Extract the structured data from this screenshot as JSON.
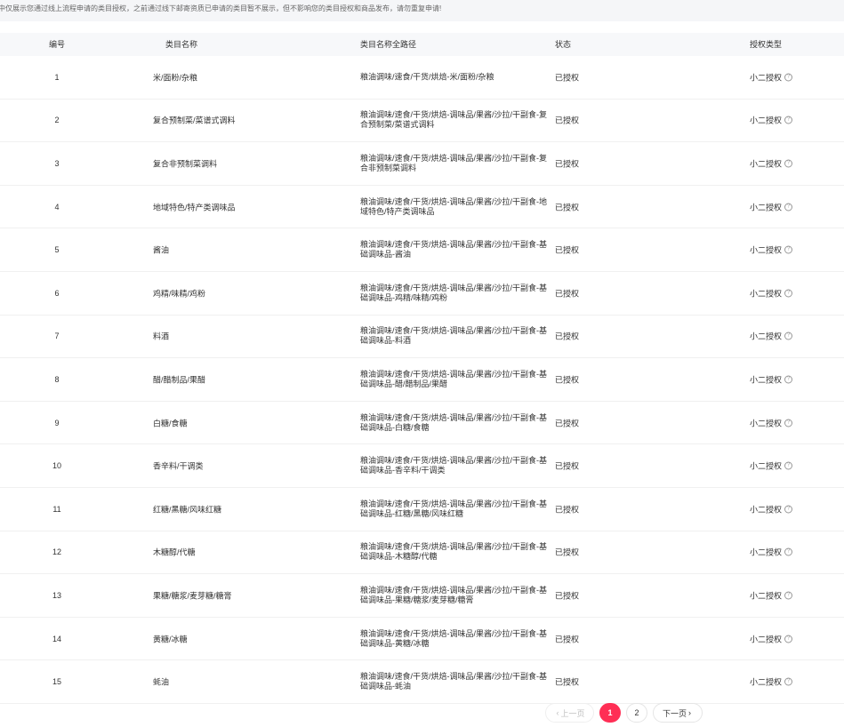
{
  "notice": "中仅展示您通过线上流程申请的类目授权，之前通过线下邮寄资质已申请的类目暂不展示，但不影响您的类目授权和商品发布，请勿重复申请!",
  "table": {
    "headers": {
      "no": "编号",
      "name": "类目名称",
      "path": "类目名称全路径",
      "status": "状态",
      "type": "授权类型"
    },
    "rows": [
      {
        "no": "1",
        "name": "米/面粉/杂粮",
        "path": "粮油调味/速食/干货/烘焙-米/面粉/杂粮",
        "status": "已授权",
        "type": "小二授权"
      },
      {
        "no": "2",
        "name": "复合预制菜/菜谱式调料",
        "path": "粮油调味/速食/干货/烘焙-调味品/果酱/沙拉/干副食-复合预制菜/菜谱式调料",
        "status": "已授权",
        "type": "小二授权"
      },
      {
        "no": "3",
        "name": "复合非预制菜调料",
        "path": "粮油调味/速食/干货/烘焙-调味品/果酱/沙拉/干副食-复合非预制菜调料",
        "status": "已授权",
        "type": "小二授权"
      },
      {
        "no": "4",
        "name": "地域特色/特产类调味品",
        "path": "粮油调味/速食/干货/烘焙-调味品/果酱/沙拉/干副食-地域特色/特产类调味品",
        "status": "已授权",
        "type": "小二授权"
      },
      {
        "no": "5",
        "name": "酱油",
        "path": "粮油调味/速食/干货/烘焙-调味品/果酱/沙拉/干副食-基础调味品-酱油",
        "status": "已授权",
        "type": "小二授权"
      },
      {
        "no": "6",
        "name": "鸡精/味精/鸡粉",
        "path": "粮油调味/速食/干货/烘焙-调味品/果酱/沙拉/干副食-基础调味品-鸡精/味精/鸡粉",
        "status": "已授权",
        "type": "小二授权"
      },
      {
        "no": "7",
        "name": "料酒",
        "path": "粮油调味/速食/干货/烘焙-调味品/果酱/沙拉/干副食-基础调味品-料酒",
        "status": "已授权",
        "type": "小二授权"
      },
      {
        "no": "8",
        "name": "醋/醋制品/果醋",
        "path": "粮油调味/速食/干货/烘焙-调味品/果酱/沙拉/干副食-基础调味品-醋/醋制品/果醋",
        "status": "已授权",
        "type": "小二授权"
      },
      {
        "no": "9",
        "name": "白糖/食糖",
        "path": "粮油调味/速食/干货/烘焙-调味品/果酱/沙拉/干副食-基础调味品-白糖/食糖",
        "status": "已授权",
        "type": "小二授权"
      },
      {
        "no": "10",
        "name": "香辛料/干调类",
        "path": "粮油调味/速食/干货/烘焙-调味品/果酱/沙拉/干副食-基础调味品-香辛料/干调类",
        "status": "已授权",
        "type": "小二授权"
      },
      {
        "no": "11",
        "name": "红糖/黑糖/风味红糖",
        "path": "粮油调味/速食/干货/烘焙-调味品/果酱/沙拉/干副食-基础调味品-红糖/黑糖/风味红糖",
        "status": "已授权",
        "type": "小二授权"
      },
      {
        "no": "12",
        "name": "木糖醇/代糖",
        "path": "粮油调味/速食/干货/烘焙-调味品/果酱/沙拉/干副食-基础调味品-木糖醇/代糖",
        "status": "已授权",
        "type": "小二授权"
      },
      {
        "no": "13",
        "name": "果糖/糖浆/麦芽糖/糖膏",
        "path": "粮油调味/速食/干货/烘焙-调味品/果酱/沙拉/干副食-基础调味品-果糖/糖浆/麦芽糖/糖膏",
        "status": "已授权",
        "type": "小二授权"
      },
      {
        "no": "14",
        "name": "黄糖/冰糖",
        "path": "粮油调味/速食/干货/烘焙-调味品/果酱/沙拉/干副食-基础调味品-黄糖/冰糖",
        "status": "已授权",
        "type": "小二授权"
      },
      {
        "no": "15",
        "name": "蚝油",
        "path": "粮油调味/速食/干货/烘焙-调味品/果酱/沙拉/干副食-基础调味品-蚝油",
        "status": "已授权",
        "type": "小二授权"
      }
    ]
  },
  "help_icon": "help-circle-icon",
  "pagination": {
    "prev": "上一页",
    "next": "下一页",
    "pages": [
      "1",
      "2"
    ],
    "current": "1"
  },
  "colors": {
    "accent": "#ff2e55",
    "header_bg": "#f7f8fa",
    "notice_bg": "#f5f6f8"
  }
}
